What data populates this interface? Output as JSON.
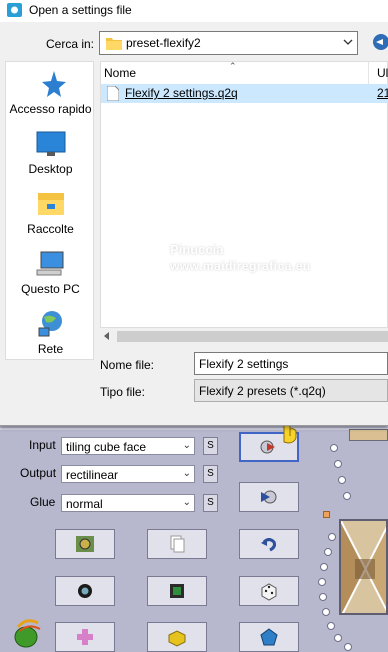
{
  "dialog": {
    "title": "Open a settings file",
    "look_in_label": "Cerca in:",
    "look_in_value": "preset-flexify2",
    "places": [
      {
        "label": "Accesso rapido",
        "icon": "star-icon"
      },
      {
        "label": "Desktop",
        "icon": "desktop-icon"
      },
      {
        "label": "Raccolte",
        "icon": "library-icon"
      },
      {
        "label": "Questo PC",
        "icon": "computer-icon"
      },
      {
        "label": "Rete",
        "icon": "network-icon"
      }
    ],
    "columns": {
      "name": "Nome",
      "second": "Ul"
    },
    "files": [
      {
        "name": "Flexify 2 settings.q2q",
        "date": "21"
      }
    ],
    "file_name_label": "Nome file:",
    "file_name_value": "Flexify 2 settings",
    "file_type_label": "Tipo file:",
    "file_type_value": "Flexify 2 presets (*.q2q)"
  },
  "watermark": {
    "title": "Pinuccia",
    "url": "www.maidiregrafica.eu"
  },
  "plugin": {
    "input_label": "Input",
    "input_value": "tiling cube face",
    "output_label": "Output",
    "output_value": "rectilinear",
    "glue_label": "Glue",
    "glue_value": "normal",
    "s_label": "S"
  },
  "colors": {
    "dialog_bg": "#f0f0f0",
    "selection": "#cce8ff",
    "plugin_bg": "#b7b8ce",
    "accent": "#2f6cb6"
  }
}
